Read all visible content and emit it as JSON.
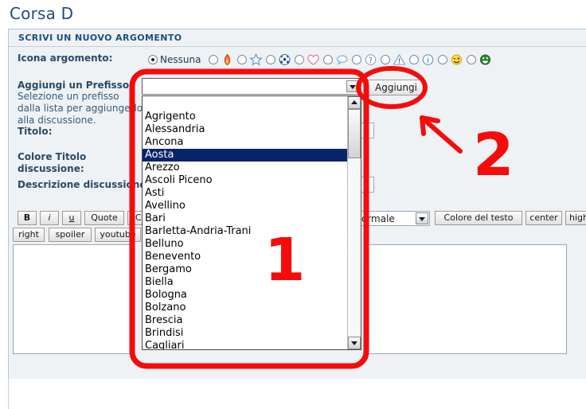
{
  "page": {
    "title": "Corsa D"
  },
  "panel": {
    "heading": "SCRIVI UN NUOVO ARGOMENTO"
  },
  "form": {
    "icon_label": "Icona argomento:",
    "prefix_label": "Aggiungi un Prefisso:",
    "prefix_help": "Selezione un prefisso dalla lista per aggiungerlo alla discussione.",
    "title_label": "Titolo:",
    "title_color_label": "Colore Titolo discussione:",
    "description_label": "Descrizione discussione:"
  },
  "icon_options": [
    {
      "name": "none",
      "label": "Nessuna",
      "checked": true,
      "icon": ""
    },
    {
      "name": "fire",
      "label": "",
      "checked": false,
      "icon": "fire-icon"
    },
    {
      "name": "star",
      "label": "",
      "checked": false,
      "icon": "star-icon"
    },
    {
      "name": "soccer",
      "label": "",
      "checked": false,
      "icon": "soccer-ball-icon"
    },
    {
      "name": "heart",
      "label": "",
      "checked": false,
      "icon": "heart-icon"
    },
    {
      "name": "speech",
      "label": "",
      "checked": false,
      "icon": "speech-bubble-icon"
    },
    {
      "name": "question",
      "label": "",
      "checked": false,
      "icon": "question-mark-icon"
    },
    {
      "name": "warning",
      "label": "",
      "checked": false,
      "icon": "warning-triangle-icon"
    },
    {
      "name": "info",
      "label": "",
      "checked": false,
      "icon": "info-circle-icon"
    },
    {
      "name": "wink",
      "label": "",
      "checked": false,
      "icon": "wink-smiley-icon"
    },
    {
      "name": "grin",
      "label": "",
      "checked": false,
      "icon": "green-grin-smiley-icon"
    }
  ],
  "prefix_combo": {
    "value": "",
    "add_button_label": "Aggiungi",
    "selected_option": "Aosta",
    "options": [
      "",
      "Agrigento",
      "Alessandria",
      "Ancona",
      "Aosta",
      "Arezzo",
      "Ascoli Piceno",
      "Asti",
      "Avellino",
      "Bari",
      "Barletta-Andria-Trani",
      "Belluno",
      "Benevento",
      "Bergamo",
      "Biella",
      "Bologna",
      "Bolzano",
      "Brescia",
      "Brindisi",
      "Cagliari"
    ]
  },
  "editor_toolbar": {
    "row1": [
      "B",
      "i",
      "u",
      "Quote",
      "Code"
    ],
    "row2": [
      "right",
      "spoiler",
      "youtube"
    ],
    "font_size_value": "Normale",
    "buttons_right": [
      "Colore del testo",
      "center",
      "high"
    ]
  },
  "annotations": [
    {
      "id": "1",
      "label": "1",
      "target": "prefix-dropdown-list"
    },
    {
      "id": "2",
      "label": "2",
      "target": "aggiungi-button"
    }
  ],
  "colors": {
    "annotation_red": "#f60b0b",
    "heading_blue": "#1d4e7d",
    "panel_bg": "#eef2f5",
    "selected_option_bg": "#0a246a"
  }
}
